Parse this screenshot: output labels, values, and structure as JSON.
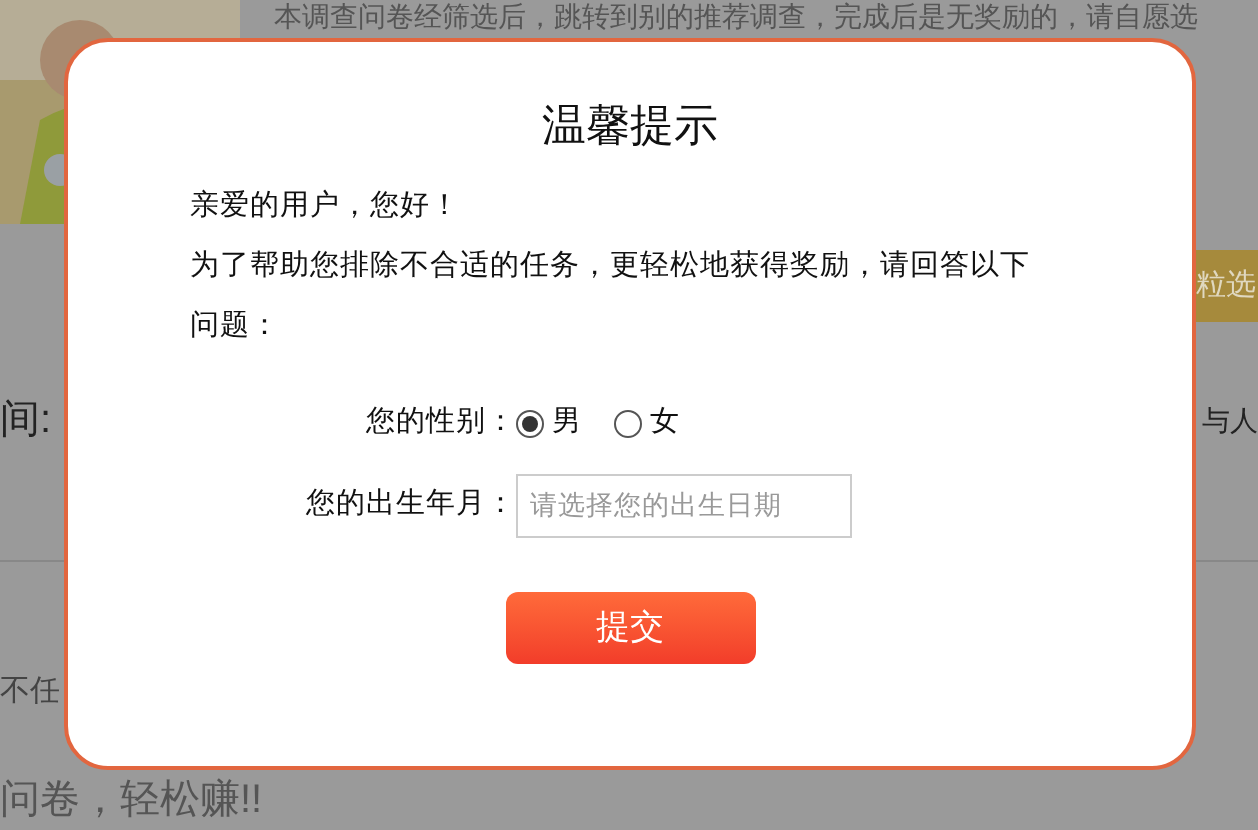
{
  "background": {
    "intro": "本调查问卷经筛选后，跳转到别的推荐调查，完成后是无奖励的，请自愿选",
    "badge": "粒选",
    "row_left": "间:",
    "row_right": "与人",
    "task_fragment": "不任",
    "slogan": "问卷，轻松赚!!"
  },
  "dialog": {
    "title": "温馨提示",
    "greeting": "亲爱的用户，您好！",
    "message": "为了帮助您排除不合适的任务，更轻松地获得奖励，请回答以下问题：",
    "gender": {
      "label": "您的性别：",
      "options": [
        {
          "label": "男",
          "selected": true
        },
        {
          "label": "女",
          "selected": false
        }
      ]
    },
    "birth": {
      "label": "您的出生年月：",
      "placeholder": "请选择您的出生日期"
    },
    "submit": "提交"
  }
}
